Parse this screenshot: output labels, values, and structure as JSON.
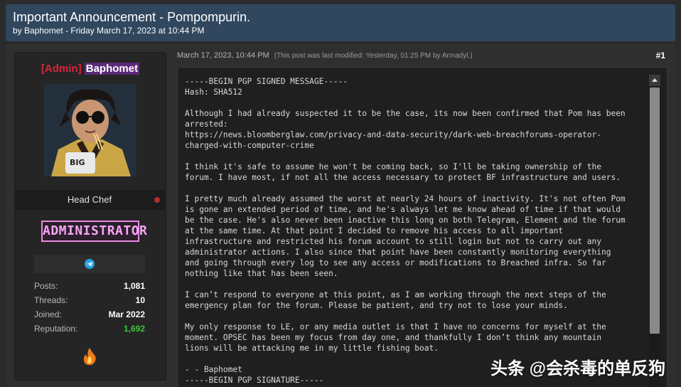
{
  "thread": {
    "title": "Important Announcement - Pompompurin.",
    "byline": "by Baphomet - Friday March 17, 2023 at 10:44 PM"
  },
  "user": {
    "tag": "[Admin]",
    "name": "Baphomet",
    "rank": "Head Chef",
    "badge": "ADMINISTRATOR",
    "stats": [
      {
        "label": "Posts:",
        "value": "1,081"
      },
      {
        "label": "Threads:",
        "value": "10"
      },
      {
        "label": "Joined:",
        "value": "Mar 2022"
      },
      {
        "label": "Reputation:",
        "value": "1,692"
      }
    ]
  },
  "post": {
    "date": "March 17, 2023, 10:44 PM",
    "modified": "(This post was last modified: Yesterday, 01:25 PM by Armadyl.)",
    "number": "#1",
    "body": "-----BEGIN PGP SIGNED MESSAGE-----\nHash: SHA512\n\nAlthough I had already suspected it to be the case, its now been confirmed that Pom has been\narrested:\nhttps://news.bloomberglaw.com/privacy-and-data-security/dark-web-breachforums-operator-\ncharged-with-computer-crime\n\nI think it's safe to assume he won't be coming back, so I'll be taking ownership of the\nforum. I have most, if not all the access necessary to protect BF infrastructure and users.\n\nI pretty much already assumed the worst at nearly 24 hours of inactivity. It's not often Pom\nis gone an extended period of time, and he's always let me know ahead of time if that would\nbe the case. He's also never been inactive this long on both Telegram, Element and the forum\nat the same time. At that point I decided to remove his access to all important\ninfrastructure and restricted his forum account to still login but not to carry out any\nadministrator actions. I also since that point have been constantly monitoring everything\nand going through every log to see any access or modifications to Breached infra. So far\nnothing like that has been seen.\n\nI can’t respond to everyone at this point, as I am working through the next steps of the\nemergency plan for the forum. Please be patient, and try not to lose your minds.\n\nMy only response to LE, or any media outlet is that I have no concerns for myself at the\nmoment. OPSEC has been my focus from day one, and thankfully I don’t think any mountain\nlions will be attacking me in my little fishing boat.\n\n- - Baphomet\n-----BEGIN PGP SIGNATURE-----"
  },
  "watermark": "头条 @会杀毒的单反狗",
  "icons": {
    "social": "telegram-icon",
    "award": "fire-icon",
    "status": "status-dot-icon"
  },
  "colors": {
    "admin_tag": "#d9233b",
    "badge": "#f6a6f4",
    "reputation": "#3ac63a",
    "header_bg": "#30475e"
  }
}
